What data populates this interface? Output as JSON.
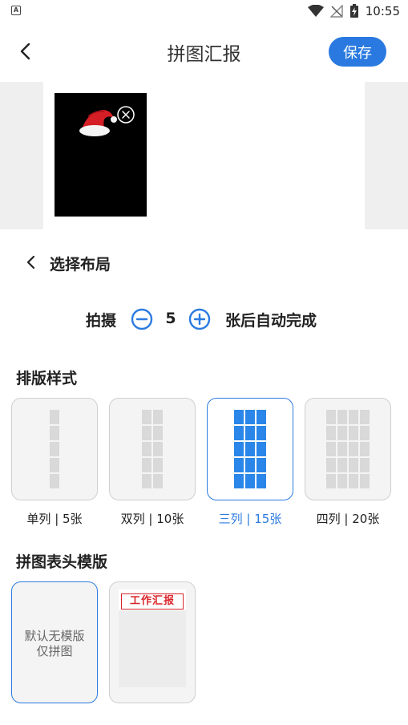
{
  "status_bar": {
    "time": "10:55",
    "left_icon": "A",
    "icons": [
      "wifi-icon",
      "signal-off-icon",
      "battery-charging-icon"
    ]
  },
  "header": {
    "title": "拼图汇报",
    "save_label": "保存",
    "back_icon": "chevron-left-icon"
  },
  "colors": {
    "accent": "#2979e0",
    "selected_border": "#2c7be0",
    "grid_selected": "#2a86e8",
    "grid_default": "#d9d9d9",
    "template_red": "#d9262b"
  },
  "layout_chooser": {
    "title": "选择布局",
    "count_prefix": "拍摄",
    "count": "5",
    "count_suffix": "张后自动完成"
  },
  "style_section": {
    "title": "排版样式",
    "options": [
      {
        "label": "单列 | 5张",
        "columns": 1,
        "selected": false
      },
      {
        "label": "双列 | 10张",
        "columns": 2,
        "selected": false
      },
      {
        "label": "三列 | 15张",
        "columns": 3,
        "selected": true
      },
      {
        "label": "四列 | 20张",
        "columns": 4,
        "selected": false
      }
    ]
  },
  "template_section": {
    "title": "拼图表头模版",
    "none_option": {
      "line1": "默认无模版",
      "line2": "仅拼图",
      "selected": true
    },
    "work_report_option": {
      "badge": "工作汇报",
      "selected": false
    }
  }
}
